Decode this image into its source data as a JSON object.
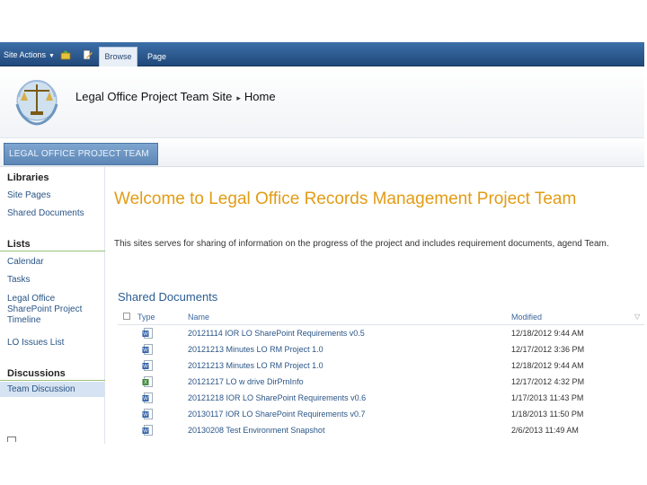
{
  "ribbon": {
    "site_actions": "Site Actions",
    "tab_browse": "Browse",
    "tab_page": "Page"
  },
  "header": {
    "site_name": "Legal Office Project Team Site",
    "breadcrumb_current": "Home"
  },
  "topnav": {
    "home_tab": "LEGAL OFFICE PROJECT TEAM SITE"
  },
  "leftnav": {
    "libraries_heading": "Libraries",
    "libraries": [
      "Site Pages",
      "Shared Documents"
    ],
    "lists_heading": "Lists",
    "lists": [
      "Calendar",
      "Tasks",
      "Legal Office SharePoint Project Timeline",
      "LO Issues List"
    ],
    "discussions_heading": "Discussions",
    "discussions": [
      "Team Discussion"
    ]
  },
  "content": {
    "welcome": "Welcome to Legal Office Records Management Project Team",
    "intro": "This sites serves for sharing of information on the progress of the project and includes requirement documents, agend Team."
  },
  "documents": {
    "title": "Shared Documents",
    "columns": {
      "type": "Type",
      "name": "Name",
      "modified": "Modified"
    },
    "rows": [
      {
        "name": "20121114 IOR LO SharePoint Requirements v0.5",
        "modified": "12/18/2012 9:44 AM",
        "icon": "word-doc-icon"
      },
      {
        "name": "20121213 Minutes LO RM Project 1.0",
        "modified": "12/17/2012 3:36 PM",
        "icon": "word-doc-icon"
      },
      {
        "name": "20121213 Minutes LO RM Project 1.0",
        "modified": "12/18/2012 9:44 AM",
        "icon": "word-doc-icon"
      },
      {
        "name": "20121217 LO w drive DirPrnInfo",
        "modified": "12/17/2012 4:32 PM",
        "icon": "excel-doc-icon"
      },
      {
        "name": "20121218 IOR LO SharePoint Requirements v0.6",
        "modified": "1/17/2013 11:43 PM",
        "icon": "word-doc-icon"
      },
      {
        "name": "20130117 IOR LO SharePoint Requirements v0.7",
        "modified": "1/18/2013 11:50 PM",
        "icon": "word-doc-icon"
      },
      {
        "name": "20130208 Test Environment Snapshot",
        "modified": "2/6/2013 11:49 AM",
        "icon": "word-doc-icon"
      }
    ]
  },
  "colors": {
    "ribbon": "#2b5a8e",
    "welcome": "#e29c15",
    "link": "#2a5587",
    "nav_separator": "#9ac27a"
  }
}
